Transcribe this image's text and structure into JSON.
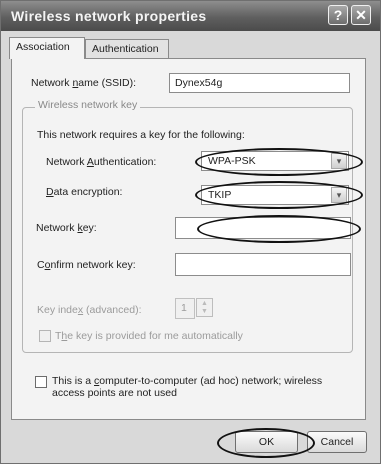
{
  "window": {
    "title": "Wireless network properties",
    "help_glyph": "?",
    "close_glyph": "✕"
  },
  "tabs": [
    {
      "label": "Association"
    },
    {
      "label": "Authentication"
    }
  ],
  "association": {
    "ssid_label_pre": "Network ",
    "ssid_label_u": "n",
    "ssid_label_post": "ame (SSID):",
    "ssid_value": "Dynex54g",
    "group_title": "Wireless network key",
    "requires_text": "This network requires a key for the following:",
    "auth_label_pre": "Network ",
    "auth_label_u": "A",
    "auth_label_post": "uthentication:",
    "auth_value": "WPA-PSK",
    "enc_label_u": "D",
    "enc_label_post": "ata encryption:",
    "enc_value": "TKIP",
    "key_label_pre": "Network ",
    "key_label_u": "k",
    "key_label_post": "ey:",
    "key_value": "",
    "confirm_label_pre": "C",
    "confirm_label_u": "o",
    "confirm_label_post": "nfirm network key:",
    "confirm_value": "",
    "index_label_pre": "Key inde",
    "index_label_u": "x",
    "index_label_post": " (advanced):",
    "index_value": "1",
    "auto_key_label_pre": "T",
    "auto_key_label_u": "h",
    "auto_key_label_post": "e key is provided for me automatically",
    "adhoc_line1_pre": "This is a ",
    "adhoc_line1_u": "c",
    "adhoc_line1_post": "omputer-to-computer (ad hoc) network; wireless",
    "adhoc_line2": "access points are not used"
  },
  "buttons": {
    "ok": "OK",
    "cancel": "Cancel"
  },
  "icons": {
    "dropdown": "chevron-down-icon",
    "spin_up": "▲",
    "spin_down": "▼",
    "dropdown_glyph": "▾"
  }
}
